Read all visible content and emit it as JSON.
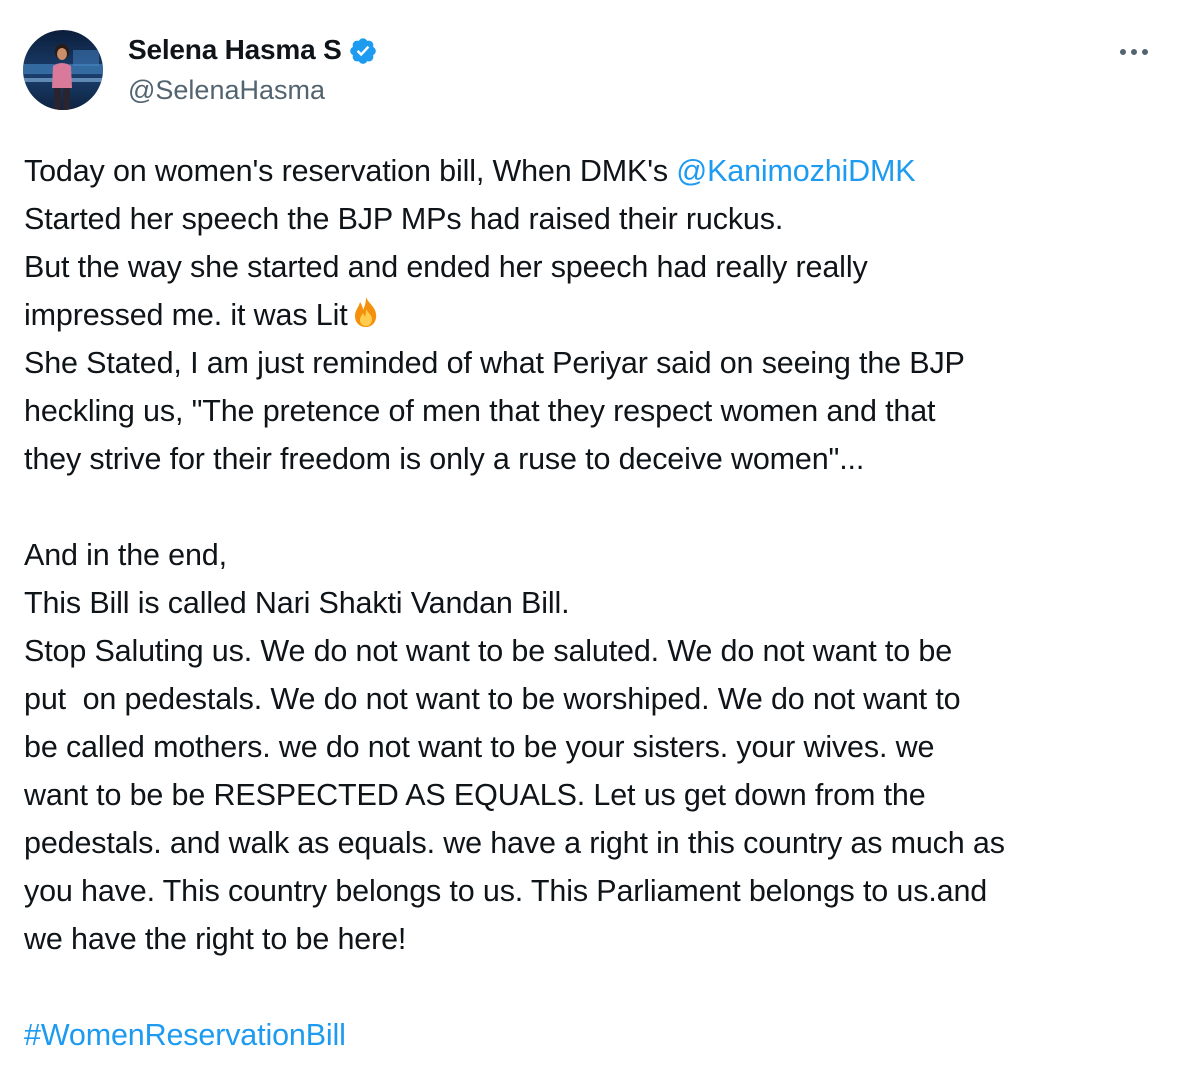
{
  "author": {
    "display_name": "Selena Hasma S",
    "handle": "@SelenaHasma",
    "verified_icon": "verified-badge-icon",
    "avatar": "avatar"
  },
  "menu": {
    "icon": "more-options-icon"
  },
  "tweet": {
    "lines": [
      {
        "pre": "Today on women's reservation bill, When DMK's ",
        "mention": "@KanimozhiDMK"
      },
      {
        "text": "Started her speech the BJP MPs had raised their ruckus."
      },
      {
        "text": "But the way she started and ended her speech had really really"
      },
      {
        "text": "impressed me. it was Lit",
        "emoji": "fire-emoji-icon"
      },
      {
        "text": "She Stated, I am just reminded of what Periyar said on seeing the BJP"
      },
      {
        "text": "heckling us, \"The pretence of men that they respect women and that"
      },
      {
        "text": "they strive for their freedom is only a ruse to deceive women\"..."
      },
      {
        "text": "And in the end,"
      },
      {
        "text": "This Bill is called Nari Shakti Vandan Bill."
      },
      {
        "text": "Stop Saluting us. We do not want to be saluted. We do not want to be"
      },
      {
        "text": "put  on pedestals. We do not want to be worshiped. We do not want to"
      },
      {
        "text": "be called mothers. we do not want to be your sisters. your wives. we"
      },
      {
        "text": "want to be be RESPECTED AS EQUALS. Let us get down from the"
      },
      {
        "text": "pedestals. and walk as equals. we have a right in this country as much as"
      },
      {
        "text": "you have. This country belongs to us. This Parliament belongs to us.and"
      },
      {
        "text": "we have the right to be here!"
      },
      {
        "hashtag": "#WomenReservationBill"
      }
    ]
  },
  "colors": {
    "link": "#1d9bf0",
    "text": "#0f1419",
    "secondary": "#536471",
    "verified": "#1d9bf0"
  }
}
